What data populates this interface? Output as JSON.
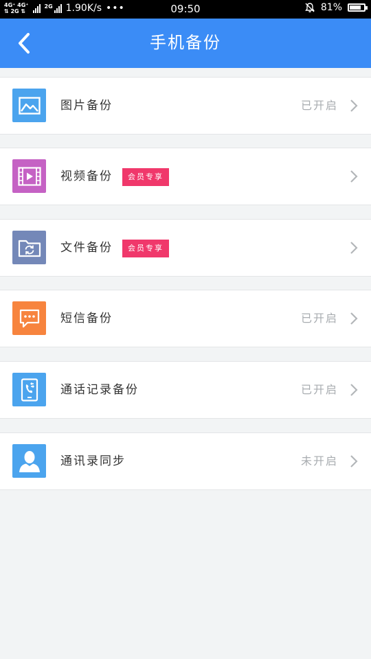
{
  "status_bar": {
    "net_top": "4G⁺ 4G⁺",
    "net_bottom": "⇅ 2G ⇅",
    "net2": "2G",
    "speed": "1.90K/s",
    "dots": "•••",
    "time": "09:50",
    "battery": "81%",
    "battery_level": 0.81
  },
  "header": {
    "title": "手机备份",
    "back_icon": "chevron-left-icon"
  },
  "colors": {
    "header": "#3b8cf6",
    "badge": "#f0386b",
    "background": "#f2f4f5"
  },
  "items": [
    {
      "label": "图片备份",
      "status": "已开启",
      "badge": "",
      "icon": "image-icon",
      "color": "#4ba4ee"
    },
    {
      "label": "视频备份",
      "status": "",
      "badge": "会员专享",
      "icon": "video-icon",
      "color": "#c562c4"
    },
    {
      "label": "文件备份",
      "status": "",
      "badge": "会员专享",
      "icon": "folder-sync-icon",
      "color": "#7488b8"
    },
    {
      "label": "短信备份",
      "status": "已开启",
      "badge": "",
      "icon": "message-icon",
      "color": "#f7843e"
    },
    {
      "label": "通话记录备份",
      "status": "已开启",
      "badge": "",
      "icon": "call-log-icon",
      "color": "#4ba4ee"
    },
    {
      "label": "通讯录同步",
      "status": "未开启",
      "badge": "",
      "icon": "contact-icon",
      "color": "#4ba4ee"
    }
  ]
}
